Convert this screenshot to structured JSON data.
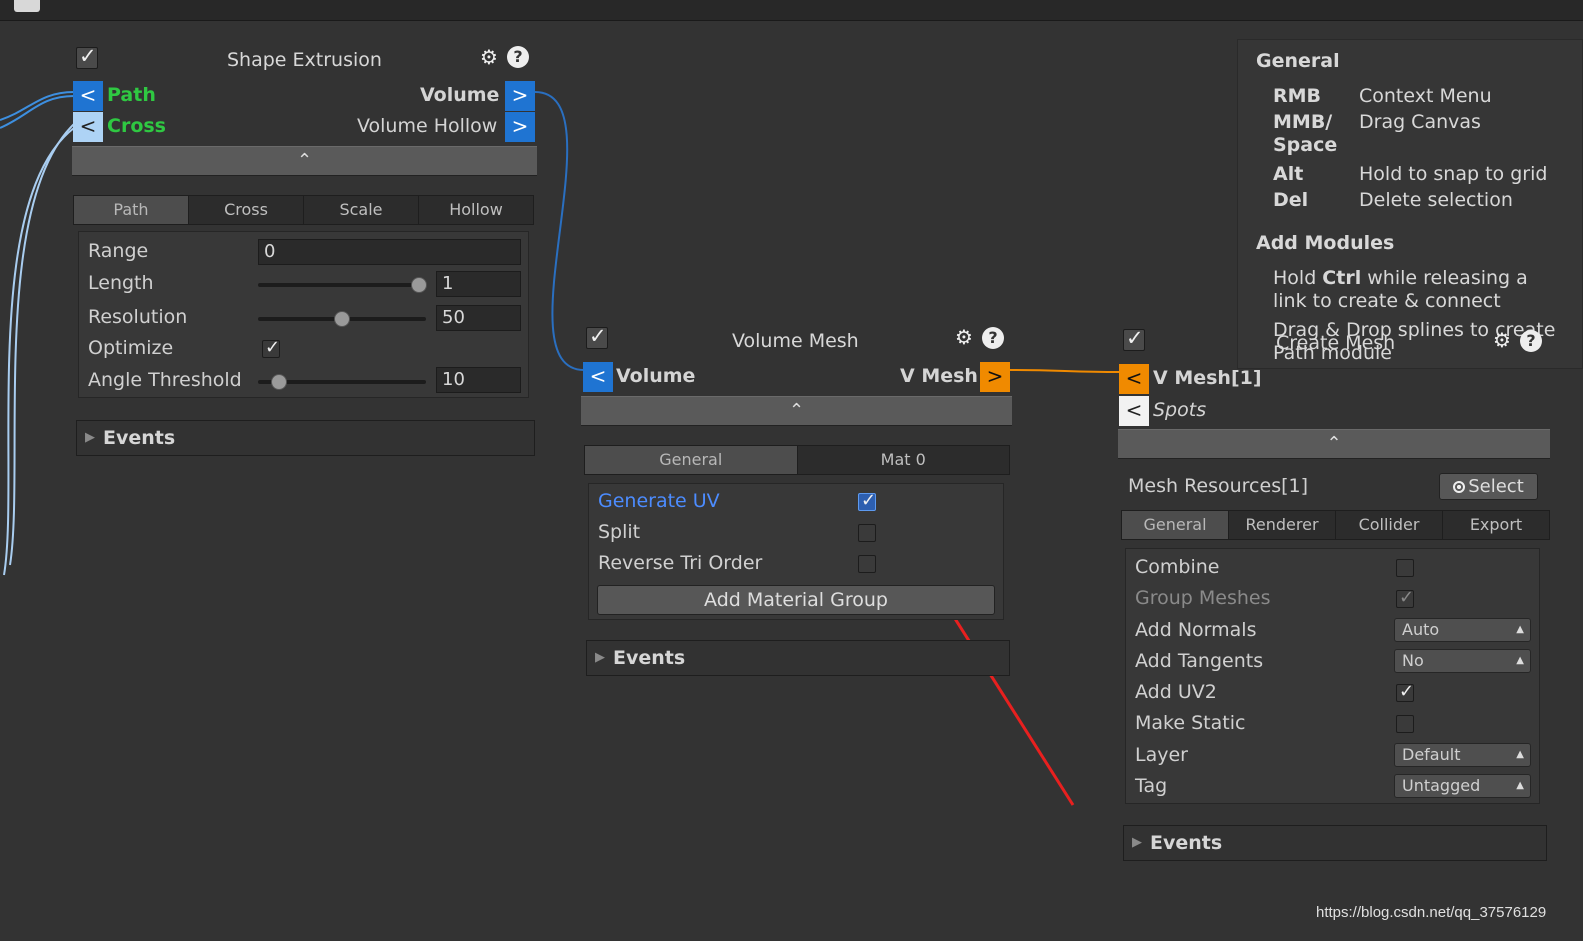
{
  "watermark": "https://blog.csdn.net/qq_37576129",
  "colors": {
    "port_blue": "#1f74d2",
    "port_orange": "#f08a00",
    "label_green": "#2fc842",
    "highlight_blue": "#4c8cff",
    "annotation_red": "#e8201f"
  },
  "icons": {
    "settings": "gear-icon",
    "help": "help-icon",
    "collapse": "chevron-up-icon",
    "foldout": "triangle-right-icon",
    "select": "radio-icon",
    "toolbar": "camera-icon"
  },
  "shape_extrusion": {
    "title": "Shape Extrusion",
    "port_in_path_arrow": "<",
    "port_in_path": "Path",
    "port_in_cross_arrow": "<",
    "port_in_cross": "Cross",
    "port_out_volume": "Volume",
    "port_out_volume_arrow": ">",
    "port_out_hollow": "Volume Hollow",
    "port_out_hollow_arrow": ">",
    "collapse": "⌃",
    "tabs": [
      "Path",
      "Cross",
      "Scale",
      "Hollow"
    ],
    "range_label": "Range",
    "range_value": "0",
    "length_label": "Length",
    "length_value": "1",
    "resolution_label": "Resolution",
    "resolution_value": "50",
    "optimize_label": "Optimize",
    "angle_label": "Angle Threshold",
    "angle_value": "10",
    "events": "Events"
  },
  "volume_mesh": {
    "title": "Volume Mesh",
    "port_in_arrow": "<",
    "port_in": "Volume",
    "port_out": "V Mesh",
    "port_out_arrow": ">",
    "collapse": "⌃",
    "tabs": [
      "General",
      "Mat 0"
    ],
    "generate_uv": "Generate UV",
    "split": "Split",
    "reverse": "Reverse Tri Order",
    "add_material": "Add Material Group",
    "events": "Events"
  },
  "create_mesh": {
    "title": "Create Mesh",
    "port_vmesh_arrow": "<",
    "port_vmesh": "V Mesh[1]",
    "port_spots_arrow": "<",
    "port_spots": "Spots",
    "collapse": "⌃",
    "resources": "Mesh Resources[1]",
    "select": "Select",
    "tabs": [
      "General",
      "Renderer",
      "Collider",
      "Export"
    ],
    "combine": "Combine",
    "group": "Group Meshes",
    "normals": "Add Normals",
    "normals_value": "Auto",
    "tangents": "Add Tangents",
    "tangents_value": "No",
    "uv2": "Add UV2",
    "static": "Make Static",
    "layer": "Layer",
    "layer_value": "Default",
    "tag": "Tag",
    "tag_value": "Untagged",
    "events": "Events"
  },
  "help": {
    "general": "General",
    "rmb": "RMB",
    "rmb_v": "Context Menu",
    "mmb1": "MMB/",
    "mmb2": "Space",
    "mmb_v": "Drag Canvas",
    "alt": "Alt",
    "alt_v": "Hold to snap to grid",
    "del": "Del",
    "del_v": "Delete selection",
    "add_modules": "Add Modules",
    "hold_pre": "Hold ",
    "hold_key": "Ctrl",
    "hold_post": " while releasing a",
    "hold_line2": "link to create & connect",
    "drag1": "Drag & Drop splines to create",
    "drag2": "Path module"
  }
}
